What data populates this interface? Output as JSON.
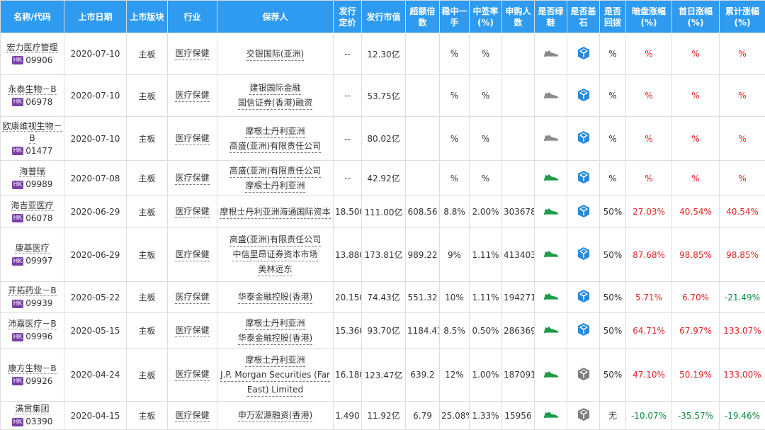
{
  "colors": {
    "header_bg": "#2e9bf0",
    "up": "#e02424",
    "down": "#0a8a3a",
    "shoe_active": "#1f9a4a",
    "shoe_inactive": "#8a8a8a",
    "cube_blue": "#2a8ad8",
    "cube_grey": "#7d7d7d",
    "hk_badge": "#7a3fa8"
  },
  "headers": [
    "名称/代码",
    "上市日期",
    "上市版块",
    "行业",
    "保荐人",
    "发行定价",
    "发行市值",
    "超额倍数",
    "稳中一手",
    "中签率(%)",
    "申购人数",
    "是否绿鞋",
    "是否基石",
    "是否回拨",
    "暗盘涨幅(%)",
    "首日涨幅(%)",
    "累计涨幅(%)"
  ],
  "rows": [
    {
      "name": "宏力医疗管理",
      "market": "HK",
      "code": "09906",
      "date": "2020-07-10",
      "board": "主板",
      "industry": "医疗保健",
      "sponsors": [
        "交银国际(亚洲)"
      ],
      "price": "--",
      "mcap": "12.30亿",
      "over": "",
      "lot": "%",
      "rate": "%",
      "applicants": "",
      "greenshoe": "inactive",
      "cornerstone": "blue",
      "clawback": "%",
      "dark": "%",
      "first": "%",
      "cum": "%",
      "dark_c": "red",
      "first_c": "red",
      "cum_c": "red"
    },
    {
      "name": "永泰生物－B",
      "market": "HK",
      "code": "06978",
      "date": "2020-07-10",
      "board": "主板",
      "industry": "医疗保健",
      "sponsors": [
        "建银国际金融",
        "国信证券(香港)融资"
      ],
      "price": "--",
      "mcap": "53.75亿",
      "over": "",
      "lot": "%",
      "rate": "%",
      "applicants": "",
      "greenshoe": "inactive",
      "cornerstone": "blue",
      "clawback": "%",
      "dark": "%",
      "first": "%",
      "cum": "%",
      "dark_c": "red",
      "first_c": "red",
      "cum_c": "red"
    },
    {
      "name": "欧康维视生物－B",
      "market": "HK",
      "code": "01477",
      "date": "2020-07-10",
      "board": "主板",
      "industry": "医疗保健",
      "sponsors": [
        "摩根士丹利亚洲",
        "高盛(亚洲)有限责任公司"
      ],
      "price": "--",
      "mcap": "80.02亿",
      "over": "",
      "lot": "%",
      "rate": "%",
      "applicants": "",
      "greenshoe": "inactive",
      "cornerstone": "blue",
      "clawback": "%",
      "dark": "%",
      "first": "%",
      "cum": "%",
      "dark_c": "red",
      "first_c": "red",
      "cum_c": "red"
    },
    {
      "name": "海普瑞",
      "market": "HK",
      "code": "09989",
      "date": "2020-07-08",
      "board": "主板",
      "industry": "医疗保健",
      "sponsors": [
        "高盛(亚洲)有限责任公司",
        "摩根士丹利亚洲"
      ],
      "price": "--",
      "mcap": "42.92亿",
      "over": "",
      "lot": "%",
      "rate": "%",
      "applicants": "",
      "greenshoe": "active",
      "cornerstone": "blue",
      "clawback": "%",
      "dark": "%",
      "first": "%",
      "cum": "%",
      "dark_c": "red",
      "first_c": "red",
      "cum_c": "red"
    },
    {
      "name": "海吉亚医疗",
      "market": "HK",
      "code": "06078",
      "date": "2020-06-29",
      "board": "主板",
      "industry": "医疗保健",
      "sponsors": [
        "摩根士丹利亚洲海通国际资本"
      ],
      "price": "18.500",
      "mcap": "111.00亿",
      "over": "608.56",
      "lot": "8.8%",
      "rate": "2.00%",
      "applicants": "303678",
      "greenshoe": "active",
      "cornerstone": "blue",
      "clawback": "50%",
      "dark": "27.03%",
      "first": "40.54%",
      "cum": "40.54%",
      "dark_c": "red",
      "first_c": "red",
      "cum_c": "red"
    },
    {
      "name": "康基医疗",
      "market": "HK",
      "code": "09997",
      "date": "2020-06-29",
      "board": "主板",
      "industry": "医疗保健",
      "sponsors": [
        "高盛(亚洲)有限责任公司",
        "中信里昂证券资本市场",
        "美林远东"
      ],
      "price": "13.880",
      "mcap": "173.81亿",
      "over": "989.22",
      "lot": "9%",
      "rate": "1.11%",
      "applicants": "413403",
      "greenshoe": "active",
      "cornerstone": "blue",
      "clawback": "50%",
      "dark": "87.68%",
      "first": "98.85%",
      "cum": "98.85%",
      "dark_c": "red",
      "first_c": "red",
      "cum_c": "red"
    },
    {
      "name": "开拓药业－B",
      "market": "HK",
      "code": "09939",
      "date": "2020-05-22",
      "board": "主板",
      "industry": "医疗保健",
      "sponsors": [
        "华泰金融控股(香港)"
      ],
      "price": "20.150",
      "mcap": "74.43亿",
      "over": "551.32",
      "lot": "10%",
      "rate": "1.11%",
      "applicants": "194271",
      "greenshoe": "active",
      "cornerstone": "blue",
      "clawback": "50%",
      "dark": "5.71%",
      "first": "6.70%",
      "cum": "-21.49%",
      "dark_c": "red",
      "first_c": "red",
      "cum_c": "green"
    },
    {
      "name": "沛嘉医疗－B",
      "market": "HK",
      "code": "09996",
      "date": "2020-05-15",
      "board": "主板",
      "industry": "医疗保健",
      "sponsors": [
        "摩根士丹利亚洲",
        "华泰金融控股(香港)"
      ],
      "price": "15.360",
      "mcap": "93.70亿",
      "over": "1184.41",
      "lot": "8.5%",
      "rate": "0.50%",
      "applicants": "286369",
      "greenshoe": "active",
      "cornerstone": "blue",
      "clawback": "50%",
      "dark": "64.71%",
      "first": "67.97%",
      "cum": "133.07%",
      "dark_c": "red",
      "first_c": "red",
      "cum_c": "red"
    },
    {
      "name": "康方生物－B",
      "market": "HK",
      "code": "09926",
      "date": "2020-04-24",
      "board": "主板",
      "industry": "医疗保健",
      "sponsors": [
        "摩根士丹利亚洲",
        "J.P. Morgan Securities (Far",
        "East) Limited"
      ],
      "price": "16.180",
      "mcap": "123.47亿",
      "over": "639.2",
      "lot": "12%",
      "rate": "1.00%",
      "applicants": "187091",
      "greenshoe": "active",
      "cornerstone": "grey",
      "clawback": "50%",
      "dark": "47.10%",
      "first": "50.19%",
      "cum": "133.00%",
      "dark_c": "red",
      "first_c": "red",
      "cum_c": "red"
    },
    {
      "name": "满贯集团",
      "market": "HK",
      "code": "03390",
      "date": "2020-04-15",
      "board": "主板",
      "industry": "医疗保健",
      "sponsors": [
        "申万宏源融资(香港)"
      ],
      "price": "1.490",
      "mcap": "11.92亿",
      "over": "6.79",
      "lot": "25.08%",
      "rate": "1.33%",
      "applicants": "15956",
      "greenshoe": "active",
      "cornerstone": "grey",
      "clawback": "无",
      "dark": "-10.07%",
      "first": "-35.57%",
      "cum": "-19.46%",
      "dark_c": "green",
      "first_c": "green",
      "cum_c": "green"
    }
  ]
}
